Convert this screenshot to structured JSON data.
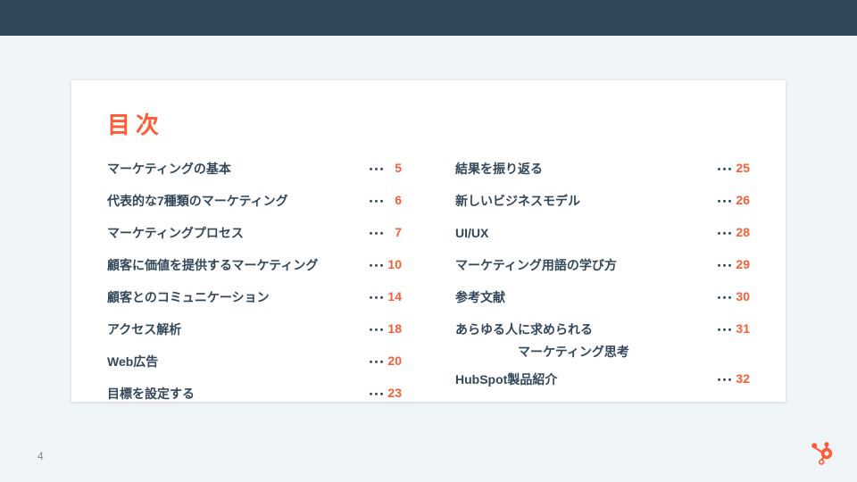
{
  "header": {
    "title": "目次"
  },
  "pageNumber": "4",
  "dots": "･･･",
  "toc": {
    "left": [
      {
        "label": "マーケティングの基本",
        "page": "5"
      },
      {
        "label": "代表的な7種類のマーケティング",
        "page": "6"
      },
      {
        "label": "マーケティングプロセス",
        "page": "7"
      },
      {
        "label": "顧客に価値を提供するマーケティング",
        "page": "10"
      },
      {
        "label": "顧客とのコミュニケーション",
        "page": "14"
      },
      {
        "label": "アクセス解析",
        "page": "18"
      },
      {
        "label": "Web広告",
        "page": "20"
      },
      {
        "label": "目標を設定する",
        "page": "23"
      }
    ],
    "right": [
      {
        "label": "結果を振り返る",
        "page": "25"
      },
      {
        "label": "新しいビジネスモデル",
        "page": "26"
      },
      {
        "label": "UI/UX",
        "page": "28"
      },
      {
        "label": "マーケティング用語の学び方",
        "page": "29"
      },
      {
        "label": "参考文献",
        "page": "30"
      },
      {
        "label": "あらゆる人に求められる",
        "sublabel": "マーケティング思考",
        "page": "31"
      },
      {
        "label": "HubSpot製品紹介",
        "page": "32"
      }
    ]
  },
  "colors": {
    "accent": "#ff5c35",
    "header": "#33475b",
    "text": "#33475b",
    "pageNum": "#7c8a98"
  }
}
